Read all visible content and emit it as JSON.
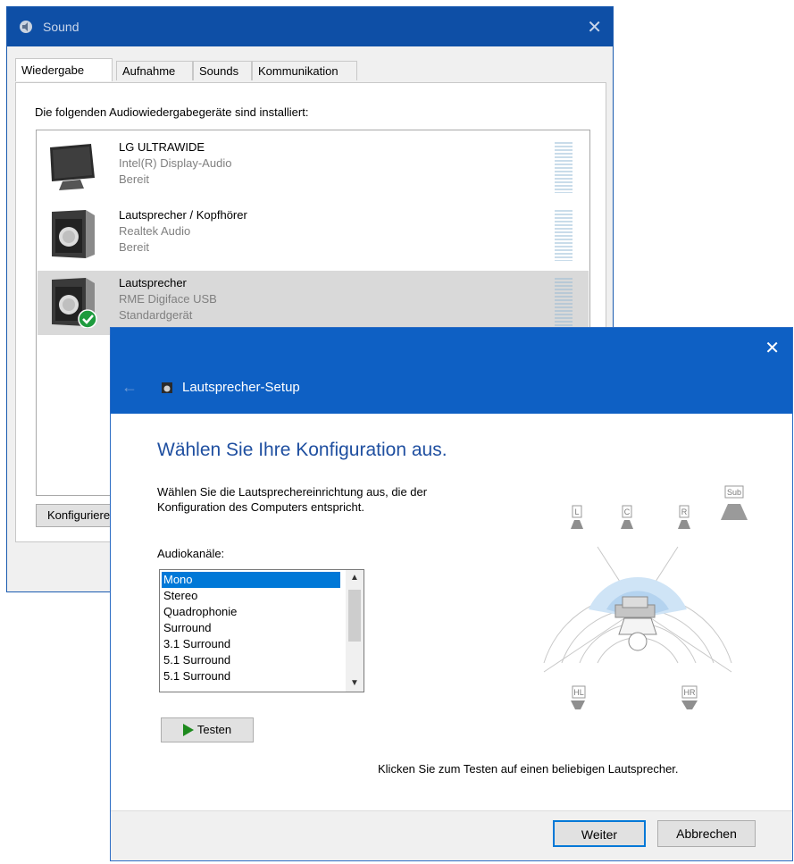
{
  "sound_window": {
    "title": "Sound",
    "close_glyph": "✕",
    "tabs": [
      {
        "label": "Wiedergabe",
        "active": true
      },
      {
        "label": "Aufnahme",
        "active": false
      },
      {
        "label": "Sounds",
        "active": false
      },
      {
        "label": "Kommunikation",
        "active": false
      }
    ],
    "intro": "Die folgenden Audiowiedergabegeräte sind installiert:",
    "devices": [
      {
        "name": "LG ULTRAWIDE",
        "driver": "Intel(R) Display-Audio",
        "status": "Bereit",
        "icon": "monitor-icon",
        "selected": false
      },
      {
        "name": "Lautsprecher / Kopfhörer",
        "driver": "Realtek Audio",
        "status": "Bereit",
        "icon": "speaker-icon",
        "selected": false
      },
      {
        "name": "Lautsprecher",
        "driver": "RME Digiface USB",
        "status": "Standardgerät",
        "icon": "speaker-icon",
        "selected": true,
        "default_badge": "check-icon"
      }
    ],
    "configure_label": "Konfigurieren"
  },
  "wizard": {
    "title": "Lautsprecher-Setup",
    "close_glyph": "✕",
    "back_glyph": "←",
    "heading": "Wählen Sie Ihre Konfiguration aus.",
    "description": "Wählen Sie die Lautsprechereinrichtung aus, die der Konfiguration des Computers entspricht.",
    "channels_label": "Audiokanäle:",
    "channels": [
      "Mono",
      "Stereo",
      "Quadrophonie",
      "Surround",
      "3.1 Surround",
      "5.1 Surround",
      "5.1 Surround"
    ],
    "selected_channel": "Mono",
    "test_label": "Testen",
    "speaker_labels": {
      "left": "L",
      "center": "C",
      "right": "R",
      "sub": "Sub",
      "rear_left": "HL",
      "rear_right": "HR"
    },
    "hint": "Klicken Sie zum Testen auf einen beliebigen Lautsprecher.",
    "next_label": "Weiter",
    "cancel_label": "Abbrechen"
  },
  "colors": {
    "sound_titlebar": "#0e4fa6",
    "wizard_header": "#0e60c4",
    "heading": "#1f4fa0",
    "selection": "#0078d7",
    "default_check": "#1e9b3e"
  }
}
